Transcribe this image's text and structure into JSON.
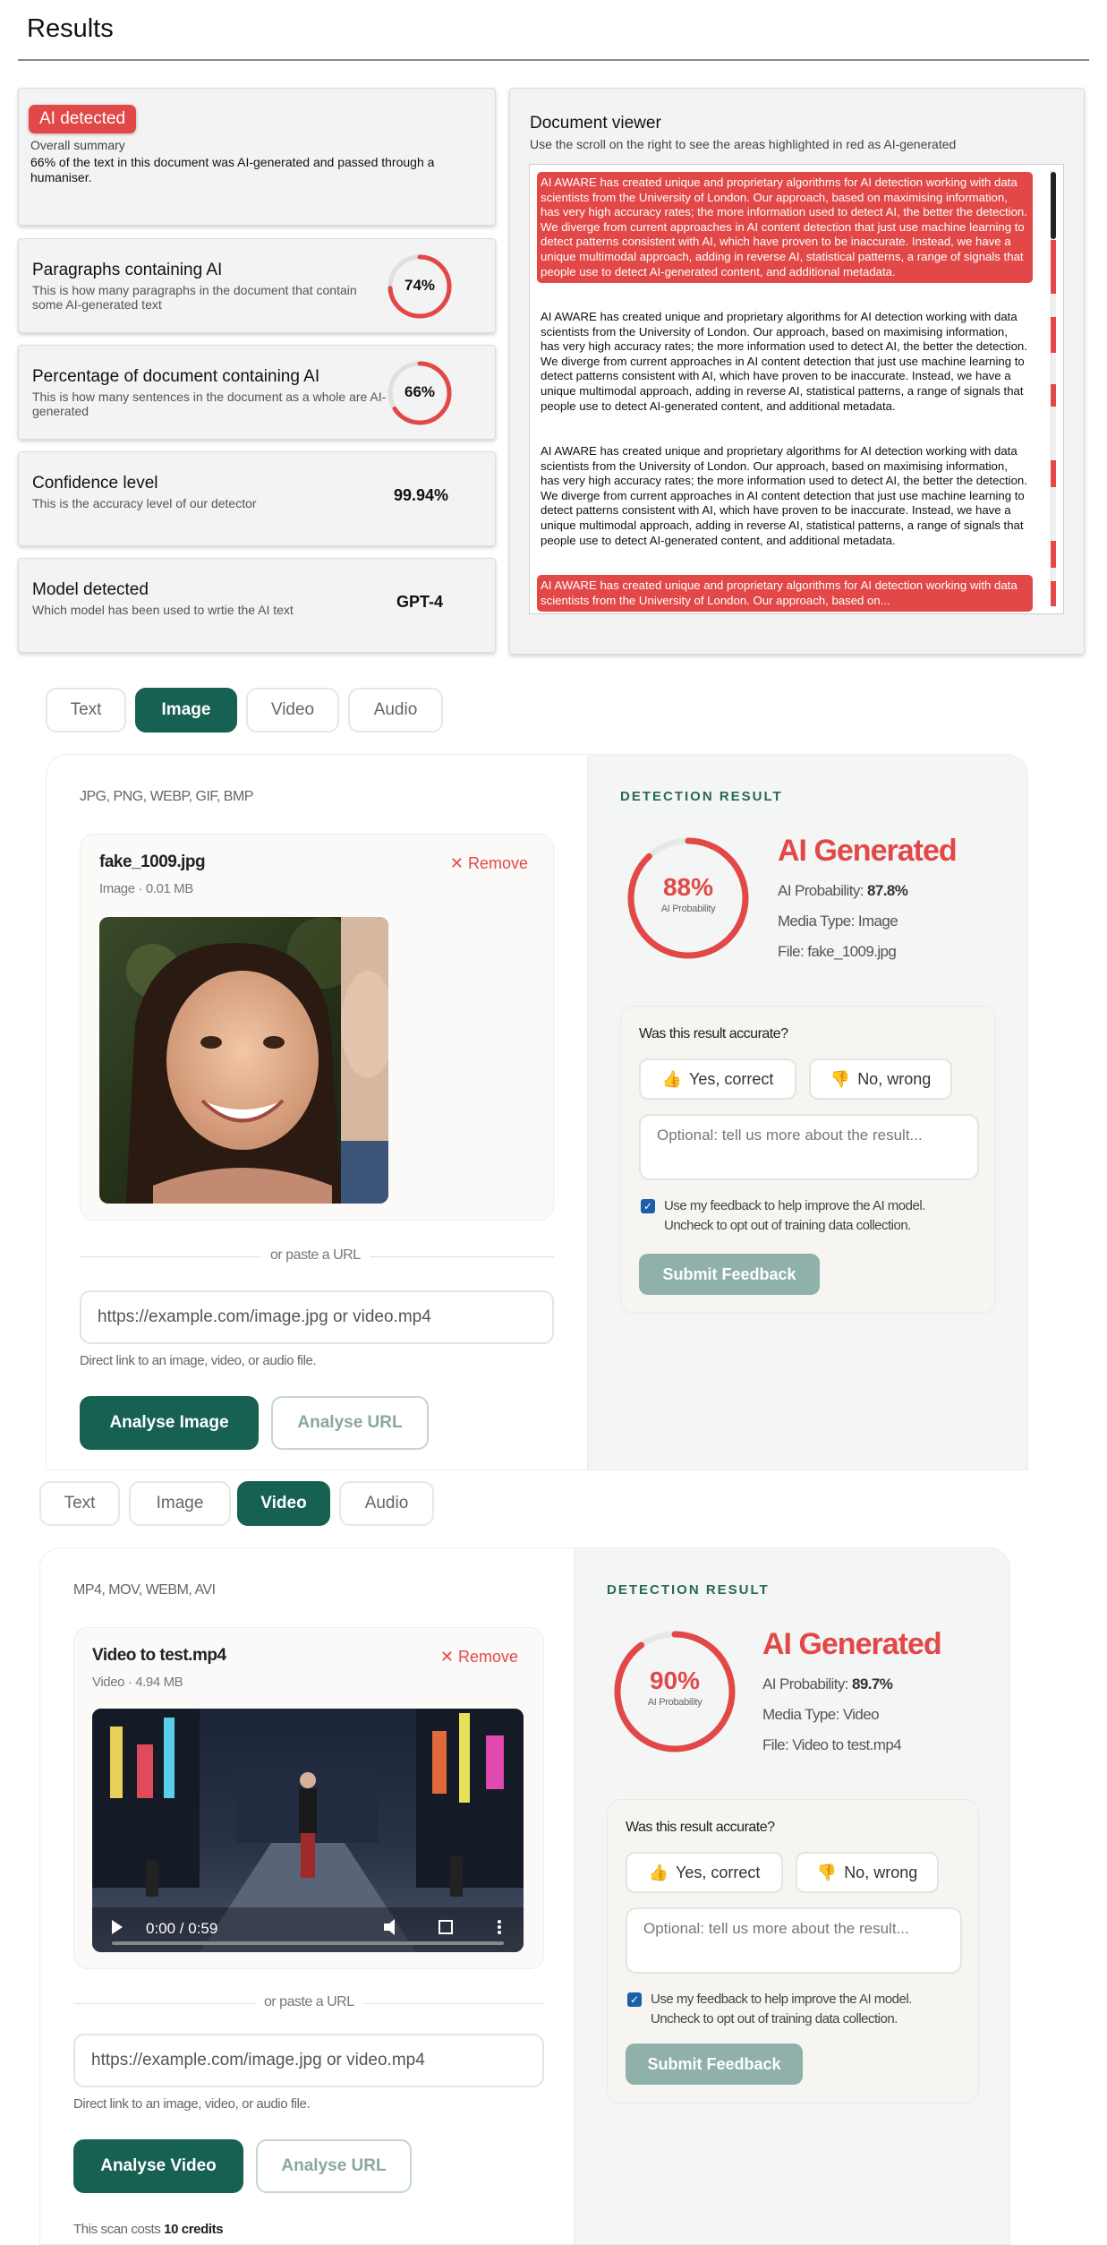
{
  "results": {
    "title": "Results",
    "badge": "AI detected",
    "summary_label": "Overall summary",
    "summary_text": "66% of the text in this document was AI-generated and passed through a humaniser.",
    "stats": [
      {
        "title": "Paragraphs containing AI",
        "desc": "This is how many paragraphs in the document that contain some AI-generated text",
        "value": "74%",
        "fraction": 0.74
      },
      {
        "title": "Percentage of document containing AI",
        "desc": "This is how many sentences in the document as a whole are AI-generated",
        "value": "66%",
        "fraction": 0.66
      },
      {
        "title": "Confidence level",
        "desc": "This is the accuracy level of our detector",
        "value": "99.94%"
      },
      {
        "title": "Model detected",
        "desc": "Which model has been used to wrtie the AI text",
        "value": "GPT-4"
      }
    ],
    "viewer": {
      "title": "Document viewer",
      "subtitle": "Use the scroll on the right to see the areas highlighted in red as AI-generated",
      "paragraph": "AI AWARE has created unique and proprietary algorithms for AI detection working with data scientists from the University of London. Our approach, based on maximising information, has very high accuracy rates; the more information used to detect AI, the better the detection. We diverge from current approaches in AI content detection that just use machine learning to detect patterns consistent with AI, which have proven to be inaccurate. Instead, we have a unique multimodal approach, adding in reverse AI, statistical patterns, a range of signals that people use to detect AI-generated content, and additional metadata.",
      "last_paragraph": "AI AWARE has created unique and proprietary algorithms for AI detection working with data scientists from the University of London. Our approach, based on..."
    }
  },
  "tabs": [
    "Text",
    "Image",
    "Video",
    "Audio"
  ],
  "colors": {
    "accent_red": "#e24848",
    "brand_green": "#176152"
  },
  "image_panel": {
    "active_tab": "Image",
    "formats": "JPG, PNG, WEBP, GIF, BMP",
    "file_name": "fake_1009.jpg",
    "file_meta": "Image · 0.01 MB",
    "remove": "✕ Remove",
    "divider": "or paste a URL",
    "url_placeholder": "https://example.com/image.jpg or video.mp4",
    "hint": "Direct link to an image, video, or audio file.",
    "analyse_btn": "Analyse Image",
    "analyse_url_btn": "Analyse URL",
    "result_label": "DETECTION RESULT",
    "pct": "88%",
    "fraction": 0.88,
    "pct_sub": "AI Probability",
    "verdict": "AI Generated",
    "prob_label": "AI Probability: ",
    "prob_value": "87.8%",
    "media_type": "Media Type: Image",
    "file_line": "File: fake_1009.jpg",
    "question": "Was this result accurate?",
    "yes": "Yes, correct",
    "no": "No, wrong",
    "feedback_placeholder": "Optional: tell us more about the result...",
    "consent": "Use my feedback to help improve the AI model. Uncheck to opt out of training data collection.",
    "submit": "Submit Feedback"
  },
  "video_panel": {
    "active_tab": "Video",
    "formats": "MP4, MOV, WEBM, AVI",
    "file_name": "Video to test.mp4",
    "file_meta": "Video · 4.94 MB",
    "remove": "✕ Remove",
    "player_time": "0:00 / 0:59",
    "divider": "or paste a URL",
    "url_placeholder": "https://example.com/image.jpg or video.mp4",
    "hint": "Direct link to an image, video, or audio file.",
    "analyse_btn": "Analyse Video",
    "analyse_url_btn": "Analyse URL",
    "cost_prefix": "This scan costs ",
    "cost_value": "10 credits",
    "result_label": "DETECTION RESULT",
    "pct": "90%",
    "fraction": 0.9,
    "pct_sub": "AI Probability",
    "verdict": "AI Generated",
    "prob_label": "AI Probability: ",
    "prob_value": "89.7%",
    "media_type": "Media Type: Video",
    "file_line": "File: Video to test.mp4",
    "question": "Was this result accurate?",
    "yes": "Yes, correct",
    "no": "No, wrong",
    "feedback_placeholder": "Optional: tell us more about the result...",
    "consent": "Use my feedback to help improve the AI model. Uncheck to opt out of training data collection.",
    "submit": "Submit Feedback"
  }
}
